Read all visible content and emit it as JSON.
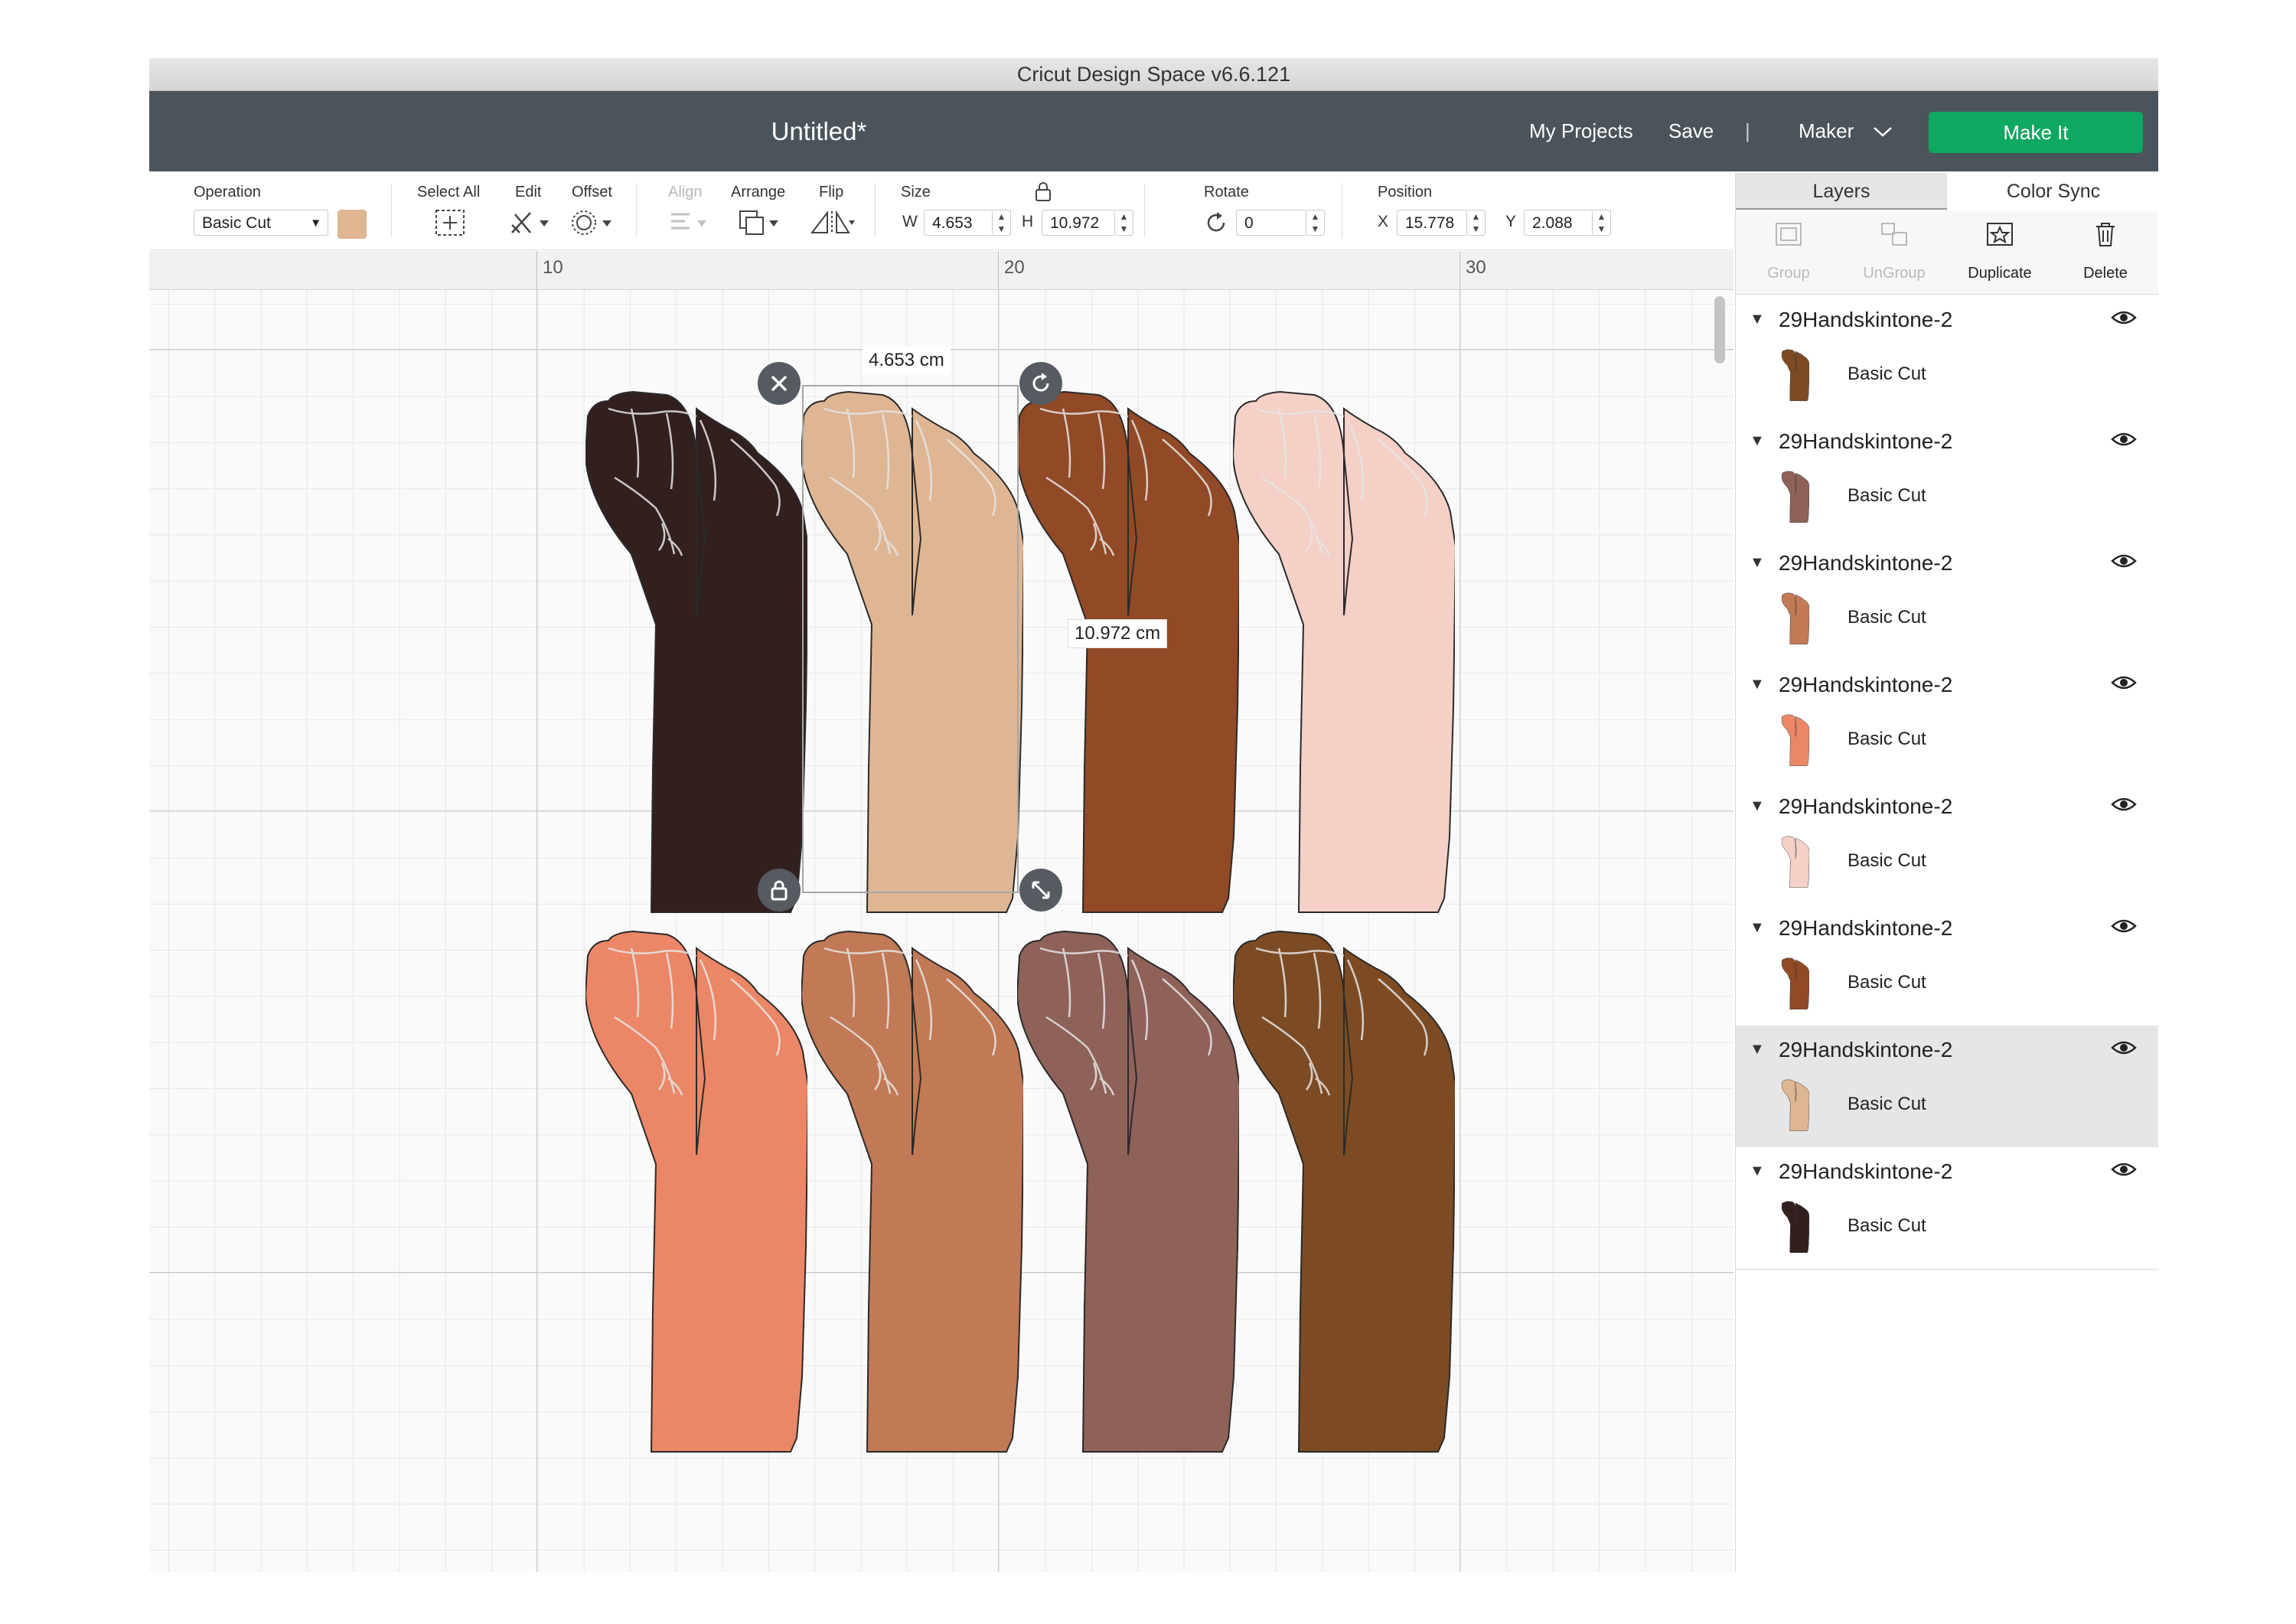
{
  "window": {
    "title": "Cricut Design Space  v6.6.121"
  },
  "header": {
    "doc_title": "Untitled*",
    "my_projects": "My Projects",
    "save": "Save",
    "separator": "|",
    "machine": "Maker",
    "make_it": "Make It"
  },
  "toolbar": {
    "operation_label": "Operation",
    "operation_value": "Basic Cut",
    "operation_color": "#e0b592",
    "select_all": "Select All",
    "edit": "Edit",
    "offset": "Offset",
    "align": "Align",
    "arrange": "Arrange",
    "flip": "Flip",
    "size_label": "Size",
    "w_letter": "W",
    "w_value": "4.653",
    "h_letter": "H",
    "h_value": "10.972",
    "rotate_label": "Rotate",
    "rotate_value": "0",
    "position_label": "Position",
    "x_letter": "X",
    "x_value": "15.778",
    "y_letter": "Y",
    "y_value": "2.088"
  },
  "ruler": {
    "labels": [
      "10",
      "20",
      "30"
    ]
  },
  "canvas": {
    "width_label": "4.653 cm",
    "height_label": "10.972 cm",
    "fist_colors": [
      "#32201f",
      "#dfb693",
      "#914926",
      "#f4d0c6",
      "#eb8766",
      "#c27955",
      "#8e6159",
      "#7c4b23"
    ]
  },
  "panel": {
    "tabs": [
      "Layers",
      "Color Sync"
    ],
    "actions": [
      "Group",
      "UnGroup",
      "Duplicate",
      "Delete"
    ],
    "layers": [
      {
        "name": "29Handskintone-2",
        "operation": "Basic Cut",
        "color": "#7c4b23",
        "selected": false
      },
      {
        "name": "29Handskintone-2",
        "operation": "Basic Cut",
        "color": "#8e6159",
        "selected": false
      },
      {
        "name": "29Handskintone-2",
        "operation": "Basic Cut",
        "color": "#c27955",
        "selected": false
      },
      {
        "name": "29Handskintone-2",
        "operation": "Basic Cut",
        "color": "#eb8766",
        "selected": false
      },
      {
        "name": "29Handskintone-2",
        "operation": "Basic Cut",
        "color": "#f4d0c6",
        "selected": false
      },
      {
        "name": "29Handskintone-2",
        "operation": "Basic Cut",
        "color": "#914926",
        "selected": false
      },
      {
        "name": "29Handskintone-2",
        "operation": "Basic Cut",
        "color": "#dfb693",
        "selected": true
      },
      {
        "name": "29Handskintone-2",
        "operation": "Basic Cut",
        "color": "#32201f",
        "selected": false
      }
    ]
  }
}
